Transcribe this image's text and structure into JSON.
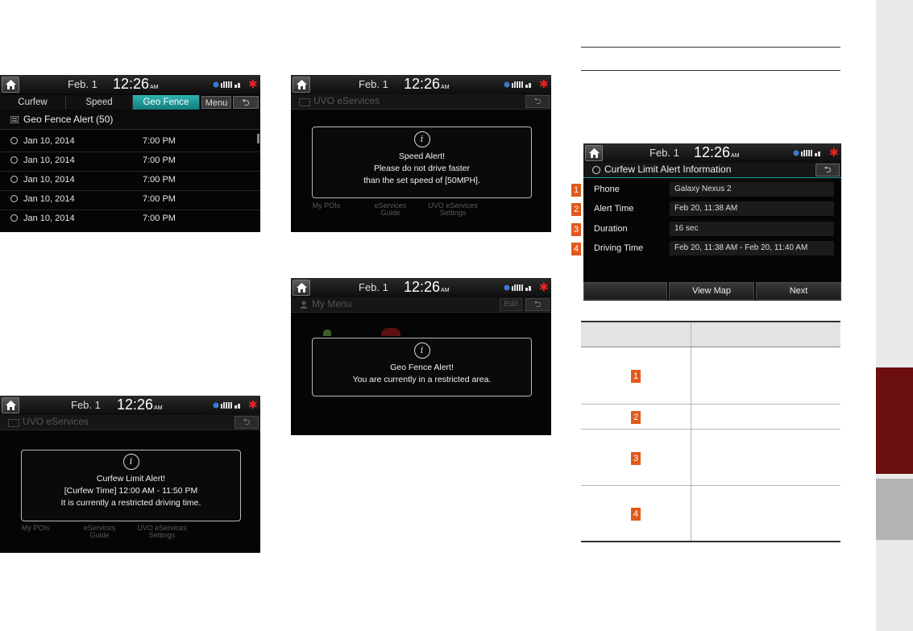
{
  "common": {
    "date": "Feb.  1",
    "time": "12:26",
    "ampm": "AM",
    "uvo_title": "UVO eServices",
    "back_glyph": "⮌",
    "menu_my_pois": "My POIs",
    "menu_eservices_guide": "eServices Guide",
    "menu_uvo_settings": "UVO eServices Settings",
    "icon_info": "i"
  },
  "screen_geofence_list": {
    "tabs": [
      "Curfew",
      "Speed",
      "Geo Fence"
    ],
    "active_tab": "Geo Fence",
    "menu_label": "Menu",
    "list_header": "Geo Fence Alert (50)",
    "rows": [
      {
        "date": "Jan 10, 2014",
        "time": "7:00 PM"
      },
      {
        "date": "Jan 10, 2014",
        "time": "7:00 PM"
      },
      {
        "date": "Jan 10, 2014",
        "time": "7:00 PM"
      },
      {
        "date": "Jan 10, 2014",
        "time": "7:00 PM"
      },
      {
        "date": "Jan 10, 2014",
        "time": "7:00 PM"
      }
    ]
  },
  "screen_speed_alert": {
    "line1": "Speed Alert!",
    "line2": "Please do not drive faster",
    "line3": "than the set speed of [50MPH]."
  },
  "screen_geofence_alert": {
    "title": "My Menu",
    "edit_label": "Edit",
    "line1": "Geo Fence Alert!",
    "line2": "You are currently in a restricted area."
  },
  "screen_curfew_alert": {
    "line1": "Curfew Limit Alert!",
    "line2": "[Curfew Time] 12:00 AM - 11:50 PM",
    "line3": "It is currently a restricted driving time."
  },
  "screen_curfew_info": {
    "title": "Curfew Limit Alert Information",
    "rows": [
      {
        "num": "1",
        "label": "Phone",
        "value": "Galaxy Nexus 2"
      },
      {
        "num": "2",
        "label": "Alert Time",
        "value": "Feb 20, 11:38 AM"
      },
      {
        "num": "3",
        "label": "Duration",
        "value": "16 sec"
      },
      {
        "num": "4",
        "label": "Driving Time",
        "value": "Feb 20, 11:38 AM - Feb 20, 11:40 AM"
      }
    ],
    "buttons": [
      "",
      "View Map",
      "Next"
    ]
  },
  "key_table": {
    "rows": [
      "1",
      "2",
      "3",
      "4"
    ]
  },
  "colors": {
    "badge": "#e2591b",
    "tab_active": "#1f9a9a",
    "side_tab_active": "#6b0e0e",
    "side_tab_inactive": "#b3b3b3",
    "right_strip": "#e9e9e9"
  }
}
